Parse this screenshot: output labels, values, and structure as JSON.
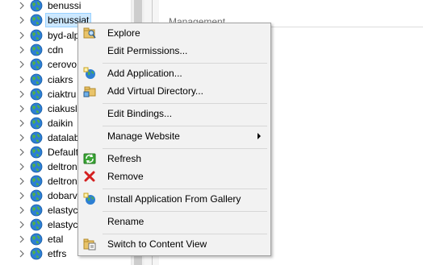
{
  "tree": {
    "items": [
      {
        "label": "benussi"
      },
      {
        "label": "benussiat"
      },
      {
        "label": "byd-alp"
      },
      {
        "label": "cdn"
      },
      {
        "label": "cerovo"
      },
      {
        "label": "ciakrs"
      },
      {
        "label": "ciaktru"
      },
      {
        "label": "ciakusl"
      },
      {
        "label": "daikin"
      },
      {
        "label": "datalab"
      },
      {
        "label": "Default"
      },
      {
        "label": "deltron"
      },
      {
        "label": "deltron"
      },
      {
        "label": "dobarv"
      },
      {
        "label": "elastyc"
      },
      {
        "label": "elastyc"
      },
      {
        "label": "etal"
      },
      {
        "label": "etfrs"
      }
    ],
    "selected_index": 1
  },
  "right_pane": {
    "section_heading": "Management"
  },
  "context_menu": {
    "items": [
      {
        "label": "Explore",
        "icon": "explore-icon"
      },
      {
        "label": "Edit Permissions...",
        "icon": ""
      },
      {
        "label": "Add Application...",
        "icon": "add-application-icon"
      },
      {
        "label": "Add Virtual Directory...",
        "icon": "add-virtual-directory-icon"
      },
      {
        "label": "Edit Bindings...",
        "icon": ""
      },
      {
        "label": "Manage Website",
        "icon": "",
        "submenu": true
      },
      {
        "label": "Refresh",
        "icon": "refresh-icon"
      },
      {
        "label": "Remove",
        "icon": "remove-icon"
      },
      {
        "label": "Install Application From Gallery",
        "icon": "gallery-icon"
      },
      {
        "label": "Rename",
        "icon": ""
      },
      {
        "label": "Switch to Content View",
        "icon": "content-view-icon"
      }
    ]
  },
  "colors": {
    "selection_bg": "#cce8ff",
    "menu_bg": "#f2f2f2",
    "remove_red": "#d42020",
    "refresh_green": "#3aa635"
  }
}
